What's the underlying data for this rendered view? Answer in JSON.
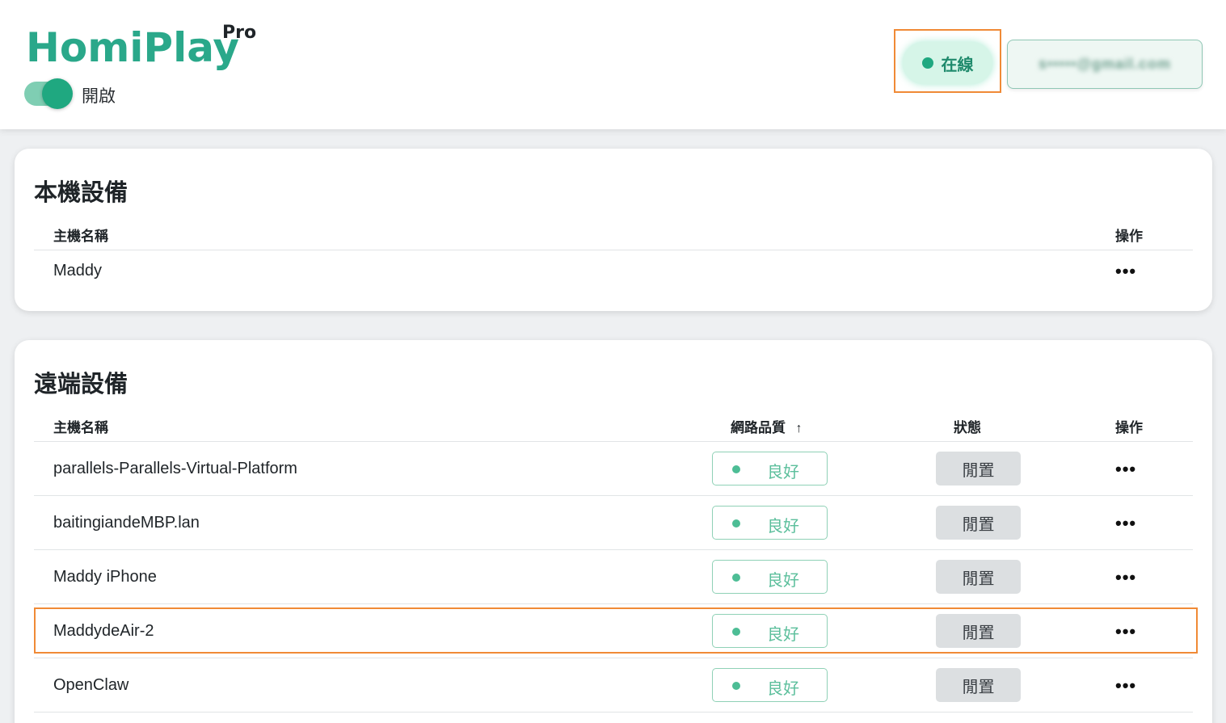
{
  "header": {
    "brand": "HomiPlay",
    "brand_tier": "Pro",
    "toggle_label": "開啟",
    "toggle_on": true,
    "status": "在線",
    "account_email": "s•••••@gmail.com"
  },
  "local": {
    "title": "本機設備",
    "col_hostname": "主機名稱",
    "col_action": "操作",
    "rows": [
      {
        "hostname": "Maddy",
        "action": "•••"
      }
    ]
  },
  "remote": {
    "title": "遠端設備",
    "col_hostname": "主機名稱",
    "col_quality": "網路品質",
    "sort_indicator": "↑",
    "col_state": "狀態",
    "col_action": "操作",
    "rows": [
      {
        "hostname": "parallels-Parallels-Virtual-Platform",
        "quality": "良好",
        "state": "閒置",
        "action": "•••"
      },
      {
        "hostname": "baitingiandeMBP.lan",
        "quality": "良好",
        "state": "閒置",
        "action": "•••"
      },
      {
        "hostname": "Maddy iPhone",
        "quality": "良好",
        "state": "閒置",
        "action": "•••"
      },
      {
        "hostname": "MaddydeAir-2",
        "quality": "良好",
        "state": "閒置",
        "action": "•••"
      },
      {
        "hostname": "OpenClaw",
        "quality": "良好",
        "state": "閒置",
        "action": "•••"
      }
    ]
  },
  "colors": {
    "brand": "#2aa88a",
    "online_bg": "#d6f5e8",
    "quality_green": "#5cbf9c",
    "highlight": "#f08a36"
  }
}
